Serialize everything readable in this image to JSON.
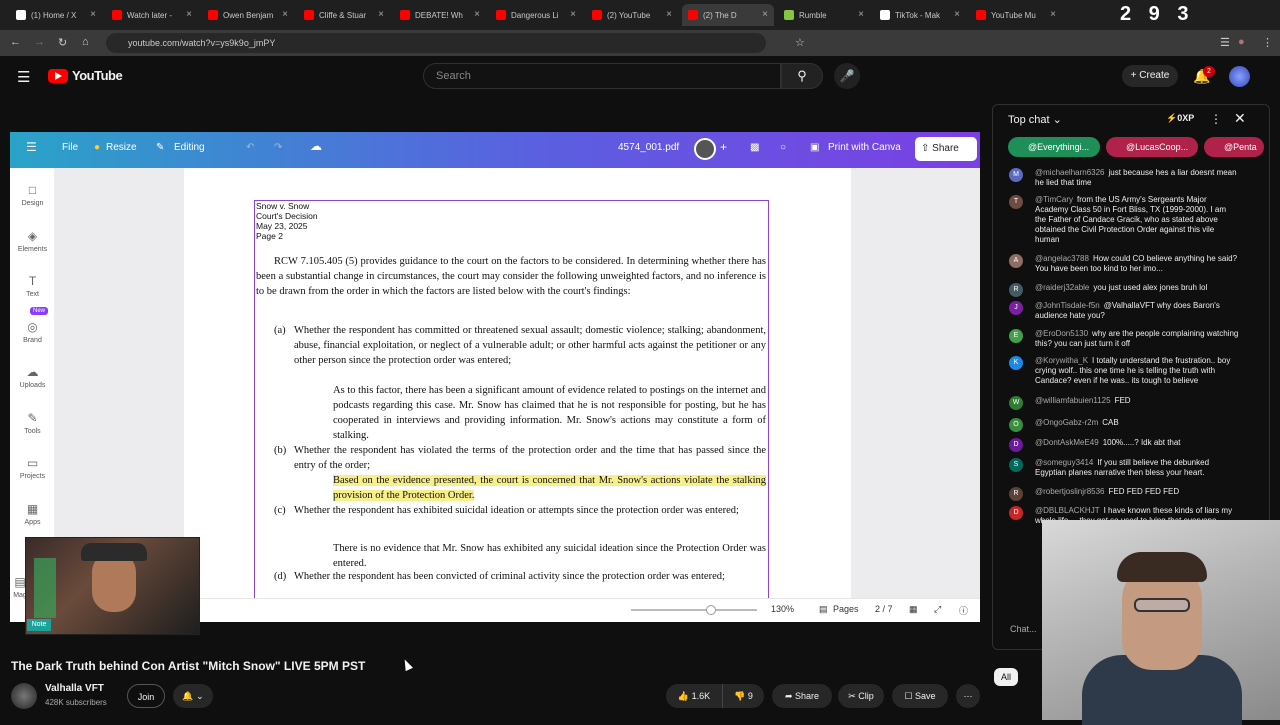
{
  "browser": {
    "tabs": [
      {
        "label": "(1) Home / X",
        "color": "#ffffff"
      },
      {
        "label": "Watch later -",
        "color": "#ff0000"
      },
      {
        "label": "Owen Benjam",
        "color": "#ff0000"
      },
      {
        "label": "Cliffe & Stuar",
        "color": "#ff0000"
      },
      {
        "label": "DEBATE! Wh",
        "color": "#ff0000"
      },
      {
        "label": "Dangerous Li",
        "color": "#ff0000"
      },
      {
        "label": "(2) YouTube",
        "color": "#ff0000"
      },
      {
        "label": "(2) The D",
        "color": "#ff0000"
      },
      {
        "label": "Rumble",
        "color": "#85c742"
      },
      {
        "label": "TikTok - Mak",
        "color": "#ffffff"
      },
      {
        "label": "YouTube Mu",
        "color": "#ff0000"
      }
    ],
    "url": "youtube.com/watch?v=ys9k9o_jmPY",
    "clock": "2 9 3"
  },
  "youtube": {
    "logo": "YouTube",
    "search_placeholder": "Search",
    "create_label": "Create",
    "notif_count": "2"
  },
  "canva": {
    "file": "File",
    "resize": "Resize",
    "editing": "Editing",
    "filename": "4574_001.pdf",
    "print": "Print with Canva",
    "share": "Share",
    "sidebar": [
      {
        "label": "Design"
      },
      {
        "label": "Elements"
      },
      {
        "label": "Text"
      },
      {
        "label": "Brand",
        "badge": "New"
      },
      {
        "label": "Uploads"
      },
      {
        "label": "Tools"
      },
      {
        "label": "Projects"
      },
      {
        "label": "Apps"
      },
      {
        "label": "Mag"
      }
    ],
    "zoom": "130%",
    "pages_label": "Pages",
    "page_indicator": "2 / 7"
  },
  "document": {
    "header": [
      "Snow v. Snow",
      "Court's Decision",
      "May 23, 2025",
      "Page 2"
    ],
    "intro": "RCW 7.105.405 (5) provides guidance to the court on the factors to be considered. In determining whether there has been a substantial change in circumstances, the court may consider the following unweighted factors, and no inference is to be drawn from the order in which the factors are listed below with the court's findings:",
    "a_label": "(a)",
    "a_text": "Whether the respondent has committed or threatened sexual assault; domestic violence; stalking; abandonment, abuse, financial exploitation, or neglect of a vulnerable adult; or other harmful acts against the petitioner or any other person since the protection order was entered;",
    "a_finding": "As to this factor, there has been a significant amount of evidence related to postings on the internet and podcasts regarding this case. Mr. Snow has claimed that he is not responsible for posting, but he has cooperated in interviews and providing information. Mr. Snow's actions may constitute a form of stalking.",
    "b_label": "(b)",
    "b_text": "Whether the respondent has violated the terms of the protection order and the time that has passed since the entry of the order;",
    "b_finding": "Based on the evidence presented, the court is concerned that Mr. Snow's actions violate the stalking provision of the Protection Order.",
    "c_label": "(c)",
    "c_text": "Whether the respondent has exhibited suicidal ideation or attempts since the protection order was entered;",
    "c_finding": "There is no evidence that Mr. Snow has exhibited any suicidal ideation since the Protection Order was entered.",
    "d_label": "(d)",
    "d_text": "Whether the respondent has been convicted of criminal activity since the protection order was entered;"
  },
  "video": {
    "title": "The Dark Truth behind Con Artist \"Mitch Snow\" LIVE 5PM PST",
    "channel": "Valhalla VFT",
    "subscribers": "428K subscribers",
    "join": "Join",
    "likes": "1.6K",
    "dislikes": "9",
    "share": "Share",
    "clip": "Clip",
    "save": "Save",
    "note": "Note"
  },
  "chat": {
    "header": "Top chat",
    "xp": "0XP",
    "chips": [
      "@Everythingi...",
      "@LucasCoop...",
      "@Penta"
    ],
    "messages": [
      {
        "initial": "M",
        "color": "#5c6bc0",
        "user": "@michaelharn6326",
        "text": "just because hes a liar doesnt mean he lied that time"
      },
      {
        "initial": "T",
        "color": "#6d4c41",
        "user": "@TimCary",
        "text": "from the US Army's Sergeants Major Academy Class 50 in Fort Bliss, TX (1999-2000). I am the Father of Candace Gracik, who as stated above obtained the Civil Protection Order against this vile human"
      },
      {
        "initial": "A",
        "color": "#8d6e63",
        "user": "@angelac3788",
        "text": "How could CO believe anything he said? You have been too kind to her imo..."
      },
      {
        "initial": "R",
        "color": "#455a64",
        "user": "@raiderj32able",
        "text": "you just used alex jones bruh lol"
      },
      {
        "initial": "J",
        "color": "#7b1fa2",
        "user": "@JohnTisdale-f5n",
        "text": "@ValhallaVFT why does Baron's audience hate you?"
      },
      {
        "initial": "E",
        "color": "#43a047",
        "user": "@EroDon5130",
        "text": "why are the people complaining watching this? you can just turn it off"
      },
      {
        "initial": "K",
        "color": "#1e88e5",
        "user": "@Korywitha_K",
        "text": "I totally understand the frustration.. boy crying wolf.. this one time he is telling the truth with Candace? even if he was.. its tough to believe"
      },
      {
        "initial": "W",
        "color": "#2e7d32",
        "user": "@williamfabuien1125",
        "text": "FED"
      },
      {
        "initial": "O",
        "color": "#388e3c",
        "user": "@OngoGabz-r2m",
        "text": "CAB"
      },
      {
        "initial": "D",
        "color": "#6a1b9a",
        "user": "@DontAskMeE49",
        "text": "100%.....? Idk abt that"
      },
      {
        "initial": "S",
        "color": "#00695c",
        "user": "@someguy3414",
        "text": "If you still believe the debunked Egyptian planes narrative then bless your heart."
      },
      {
        "initial": "R",
        "color": "#5d4037",
        "user": "@robertjoslinjr8536",
        "text": "FED FED FED FED"
      },
      {
        "initial": "D",
        "color": "#c62828",
        "user": "@DBLBLACKHJT",
        "text": "I have known these kinds of liars my whole life ... they get so used to lying that everyone"
      }
    ],
    "input_placeholder": "Chat...",
    "tab_all": "All"
  }
}
